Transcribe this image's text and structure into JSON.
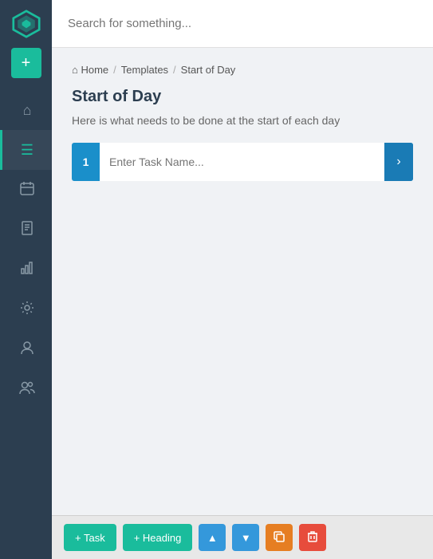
{
  "search": {
    "placeholder": "Search for something..."
  },
  "breadcrumb": {
    "home_label": "Home",
    "separator1": "/",
    "templates_label": "Templates",
    "separator2": "/",
    "current_label": "Start of Day"
  },
  "page": {
    "title": "Start of Day",
    "subtitle": "Here is what needs to be done at the start of each day"
  },
  "task_row": {
    "number": "1",
    "placeholder": "Enter Task Name..."
  },
  "toolbar": {
    "task_label": "+ Task",
    "heading_label": "+ Heading",
    "up_icon": "▲",
    "down_icon": "▼",
    "copy_icon": "⧉",
    "delete_icon": "✕"
  },
  "sidebar": {
    "nav_items": [
      {
        "name": "home",
        "icon": "⌂",
        "active": false
      },
      {
        "name": "lists",
        "icon": "☰",
        "active": true
      },
      {
        "name": "calendar",
        "icon": "📅",
        "active": false
      },
      {
        "name": "notebook",
        "icon": "📋",
        "active": false
      },
      {
        "name": "chart",
        "icon": "📊",
        "active": false
      },
      {
        "name": "settings",
        "icon": "⚙",
        "active": false
      },
      {
        "name": "user",
        "icon": "👤",
        "active": false
      },
      {
        "name": "users",
        "icon": "👥",
        "active": false
      }
    ]
  }
}
